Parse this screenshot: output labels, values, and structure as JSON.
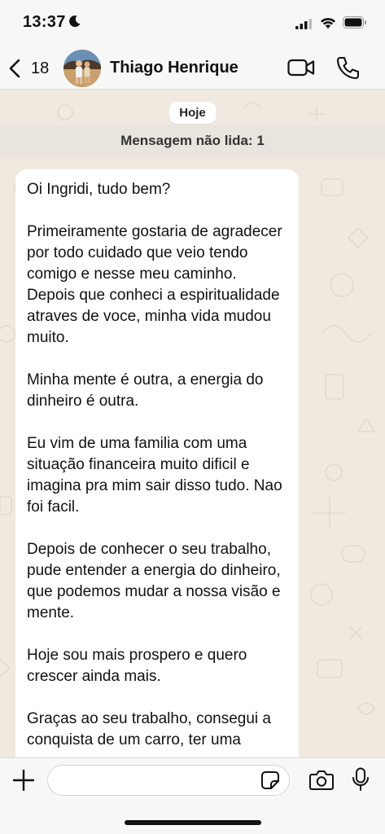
{
  "status_bar": {
    "time": "13:37"
  },
  "header": {
    "back_count": "18",
    "contact_name": "Thiago Henrique"
  },
  "chat": {
    "date_label": "Hoje",
    "unread_label": "Mensagem não lida: 1",
    "message_paragraphs": [
      "Oi Ingridi, tudo bem?",
      "Primeiramente gostaria de agradecer por todo cuidado que veio tendo comigo e nesse meu caminho. Depois que conheci a espiritualidade atraves de voce, minha vida mudou muito.",
      "Minha mente é outra, a energia do dinheiro é outra.",
      "Eu vim de uma familia com uma situação financeira muito dificil e imagina pra mim sair disso tudo. Nao foi facil.",
      "Depois de conhecer o seu trabalho, pude entender a energia do dinheiro, que podemos mudar a nossa visão e mente.",
      "Hoje sou mais prospero e quero crescer ainda mais.",
      "Graças ao seu trabalho, consegui a conquista de um carro, ter uma"
    ]
  },
  "input": {
    "placeholder": ""
  },
  "icons": {
    "status": [
      "moon-icon",
      "signal-icon",
      "wifi-icon",
      "battery-icon"
    ],
    "header": [
      "chevron-left-icon",
      "video-camera-icon",
      "phone-icon"
    ],
    "input_bar": [
      "plus-icon",
      "sticker-icon",
      "camera-icon",
      "microphone-icon"
    ]
  },
  "colors": {
    "background": "#efe9e0",
    "bubble": "#ffffff",
    "bar": "#f7f7f7",
    "icon": "#111111"
  }
}
